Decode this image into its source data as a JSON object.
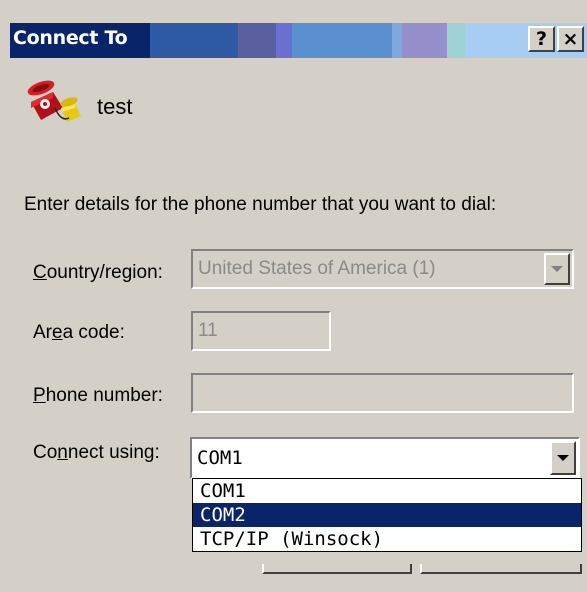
{
  "window": {
    "title": "Connect To",
    "help_button": "?",
    "close_button": "×"
  },
  "connection": {
    "name": "test",
    "icon": "phone-icon"
  },
  "instructions": "Enter details for the phone number that you want to dial:",
  "fields": {
    "country": {
      "label_pre": "",
      "label_ul": "C",
      "label_post": "ountry/region:",
      "value": "United States of America (1)"
    },
    "area_code": {
      "label_pre": "Ar",
      "label_ul": "e",
      "label_post": "a code:",
      "value": "11"
    },
    "phone": {
      "label_pre": "",
      "label_ul": "P",
      "label_post": "hone number:",
      "value": ""
    },
    "connect_using": {
      "label_pre": "Co",
      "label_ul": "n",
      "label_post": "nect using:",
      "value": "COM1"
    }
  },
  "dropdown_options": [
    "COM1",
    "COM2",
    "TCP/IP (Winsock)"
  ],
  "selected_option": "COM2",
  "colors": {
    "selection": "#0a246a",
    "dialog": "#d4d0c8"
  }
}
